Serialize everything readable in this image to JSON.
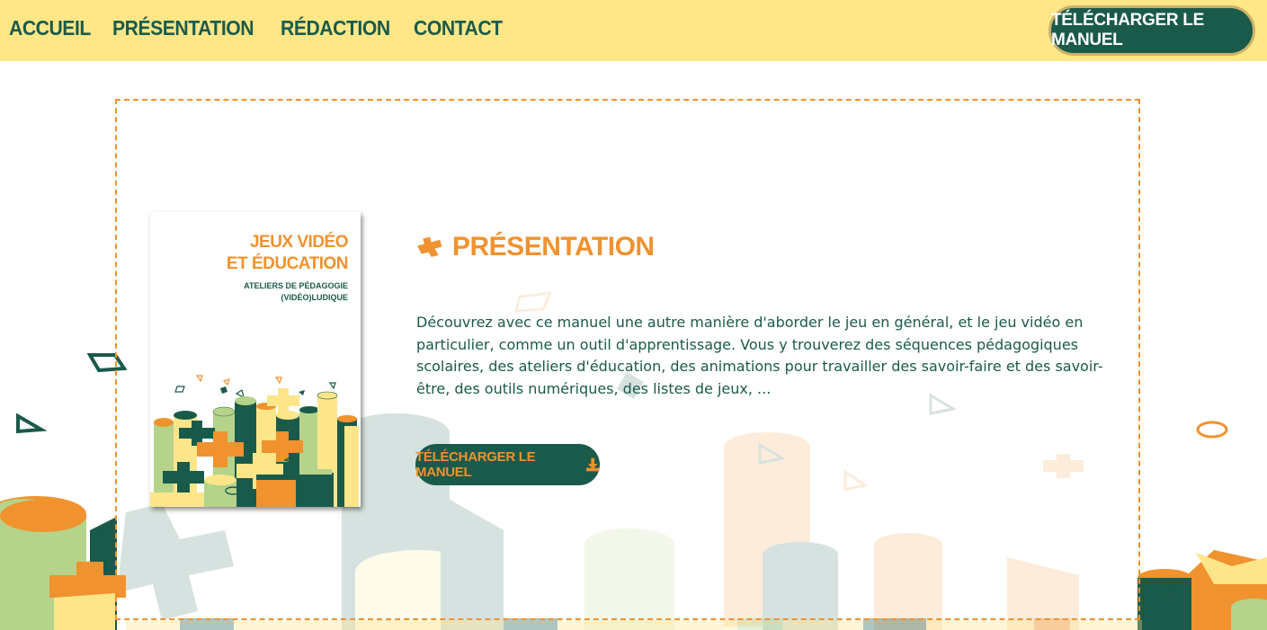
{
  "nav": {
    "items": [
      "ACCUEIL",
      "PRÉSENTATION",
      "RÉDACTION",
      "CONTACT"
    ],
    "cta_label": "TÉLÉCHARGER LE MANUEL"
  },
  "book": {
    "title_line1": "JEUX VIDÉO",
    "title_line2": "ET ÉDUCATION",
    "subtitle_line1": "ATELIERS DE PÉDAGOGIE",
    "subtitle_line2": "(VIDÉO)LUDIQUE"
  },
  "section": {
    "icon": "plus-cross-icon",
    "title": "PRÉSENTATION",
    "description": "Découvrez avec ce manuel une autre manière d'aborder le jeu en général, et le jeu vidéo en particulier, comme un outil d'apprentissage. Vous y trouverez des séquences pédagogiques scolaires, des ateliers d'éducation, des animations pour travailler des savoir-faire et des savoir-être, des outils numériques, des listes de jeux, ...",
    "download_label": "TÉLÉCHARGER LE MANUEL",
    "download_icon": "download-icon"
  },
  "colors": {
    "dark_green": "#1a5a4a",
    "orange": "#f0922e",
    "yellow": "#ffe787",
    "light_yellow": "#fde58a",
    "light_green": "#b5d38a"
  }
}
